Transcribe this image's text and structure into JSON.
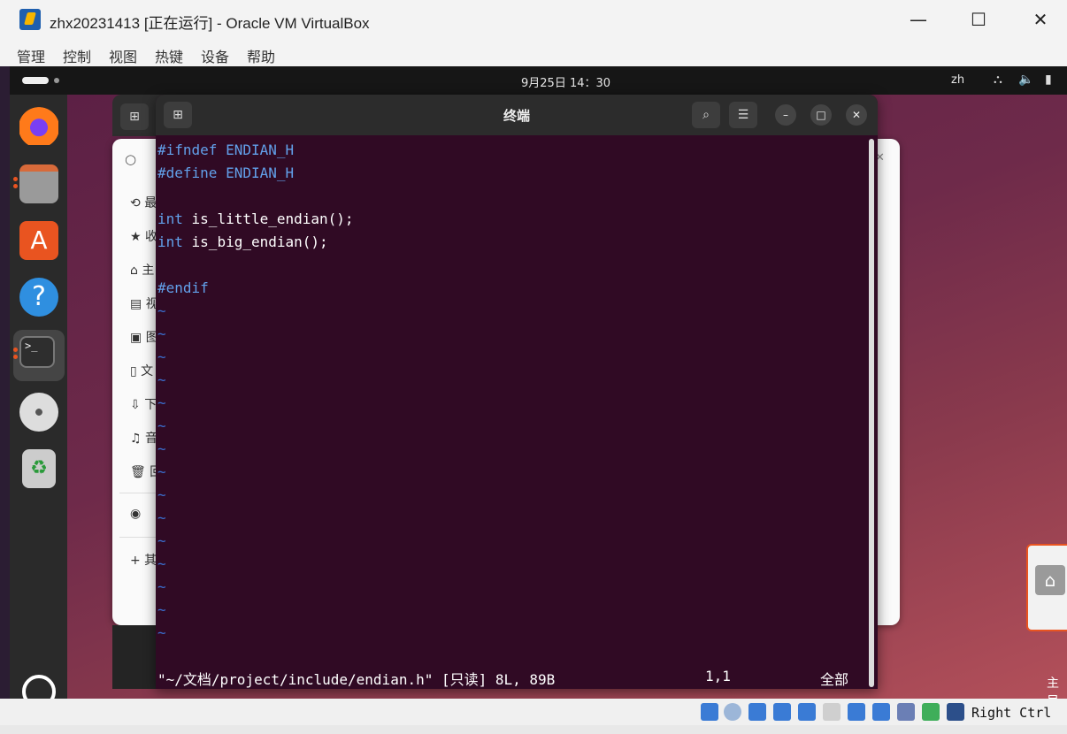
{
  "window": {
    "title": "zhx20231413 [正在运行] - Oracle VM VirtualBox",
    "minimize": "—",
    "maximize": "☐",
    "close": "✕"
  },
  "menubar": [
    "管理",
    "控制",
    "视图",
    "热键",
    "设备",
    "帮助"
  ],
  "topbar": {
    "clock": "9月25日 14：30",
    "lang": "zh"
  },
  "files_sidebar": [
    "最",
    "收",
    "主",
    "视",
    "图",
    "文",
    "下",
    "音",
    "回",
    "+ 其"
  ],
  "terminal": {
    "title": "终端",
    "lines": [
      "#ifndef ENDIAN_H",
      "#define ENDIAN_H",
      "",
      "int is_little_endian();",
      "int is_big_endian();",
      "",
      "#endif"
    ],
    "tilde_count": 15,
    "status_file": "\"~/文档/project/include/endian.h\" [只读] 8L, 89B",
    "status_pos": "1,1",
    "status_all": "全部"
  },
  "peek_label": "主目",
  "hoststatus": {
    "hotkey": "Right Ctrl"
  },
  "colors": {
    "terminal_bg": "#300a24",
    "preprocessor": "#62a0ea",
    "tilde": "#3b6fd0",
    "ubuntu_orange": "#e95420"
  }
}
